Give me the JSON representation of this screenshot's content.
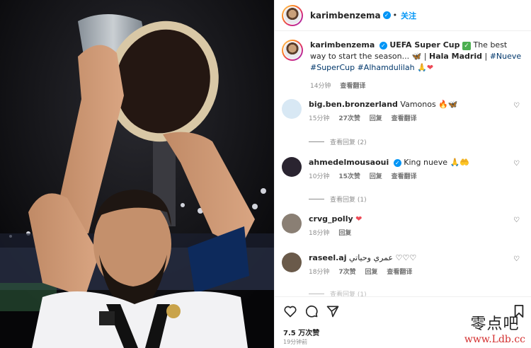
{
  "header": {
    "username": "karimbenzema",
    "follow_label": "关注",
    "dot": "•"
  },
  "caption": {
    "username": "karimbenzema",
    "text_1": "UEFA Super Cup",
    "text_2": "The best way to start the season...",
    "text_3": "| ",
    "bold": "Hala Madrid",
    "text_4": " | ",
    "tag1": "#Nueve",
    "tag2": "#SuperCup",
    "tag3": "#Alhamdulilah",
    "time": "14分钟",
    "translate": "查看翻译"
  },
  "comments": [
    {
      "username": "big.ben.bronzerland",
      "text": "Vamonos",
      "time": "15分钟",
      "likes": "27次赞",
      "reply": "回复",
      "translate": "查看翻译",
      "view_replies": "查看回复 (2)",
      "avatar_color": "#d8e8f4"
    },
    {
      "username": "ahmedelmousaoui",
      "verified": true,
      "text": "King nueve",
      "time": "10分钟",
      "likes": "15次赞",
      "reply": "回复",
      "translate": "查看翻译",
      "view_replies": "查看回复 (1)",
      "avatar_color": "#2a2430"
    },
    {
      "username": "crvg_polly",
      "text": "",
      "time": "18分钟",
      "reply": "回复",
      "avatar_color": "#8a7f74"
    },
    {
      "username": "raseel.aj",
      "text": "عمري وحياتي ♡♡♡",
      "time": "18分钟",
      "likes": "7次赞",
      "reply": "回复",
      "translate": "查看翻译",
      "view_replies": "查看回复 (1)",
      "avatar_color": "#6a5a4a"
    }
  ],
  "footer": {
    "likes": "7.5 万次赞",
    "time": "19分钟前"
  },
  "watermark": {
    "cn": "零点吧",
    "url": "www.Ldb.cc"
  },
  "colors": {
    "accent": "#0095f6",
    "heart": "#ed4956",
    "tag": "#00376b"
  }
}
